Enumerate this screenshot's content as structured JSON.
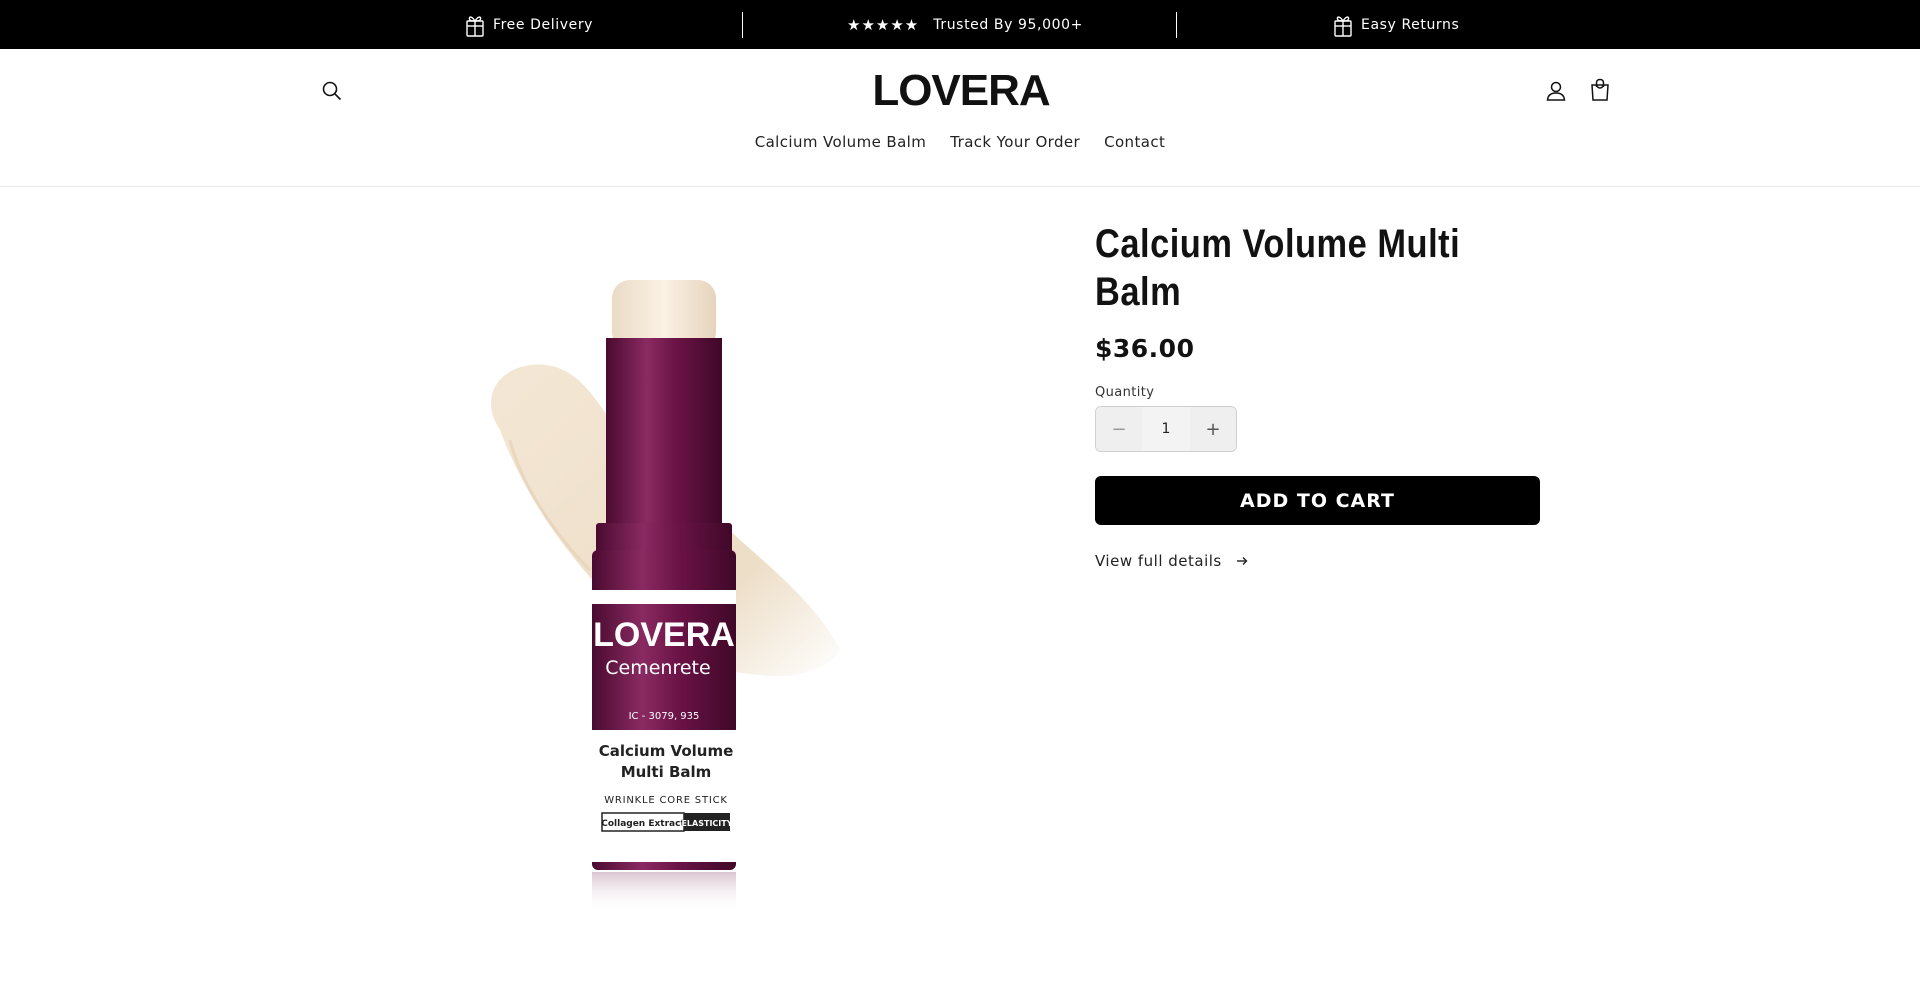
{
  "announcement": {
    "items": [
      {
        "label": "Free Delivery",
        "icon": "gift-box-icon"
      },
      {
        "label": "Trusted By 95,000+",
        "icon": "five-stars-icon",
        "stars": "★★★★★"
      },
      {
        "label": "Easy Returns",
        "icon": "gift-box-icon"
      }
    ]
  },
  "header": {
    "logo": "LOVERA",
    "search_icon": "search-icon",
    "account_icon": "account-icon",
    "cart_icon": "cart-bag-icon",
    "nav": [
      {
        "label": "Calcium Volume Balm"
      },
      {
        "label": "Track Your Order"
      },
      {
        "label": "Contact"
      }
    ]
  },
  "product": {
    "image": {
      "brand": "LOVERA",
      "sub_brand": "Cemenrete",
      "code": "IC - 3079, 935",
      "name_line1": "Calcium Volume",
      "name_line2": "Multi Balm",
      "tagline": "WRINKLE CORE STICK",
      "tag_left": "Collagen Extract",
      "tag_right": "ELASTICITY"
    },
    "title": "Calcium Volume Multi Balm",
    "price": "$36.00",
    "quantity_label": "Quantity",
    "quantity_value": "1",
    "minus": "−",
    "plus": "+",
    "add_to_cart": "ADD TO CART",
    "view_details": "View full details"
  },
  "colors": {
    "topbar_bg": "#000000",
    "button_bg": "#000000",
    "tube_plum": "#6b1346",
    "balm_cream": "#f1e4d2"
  }
}
